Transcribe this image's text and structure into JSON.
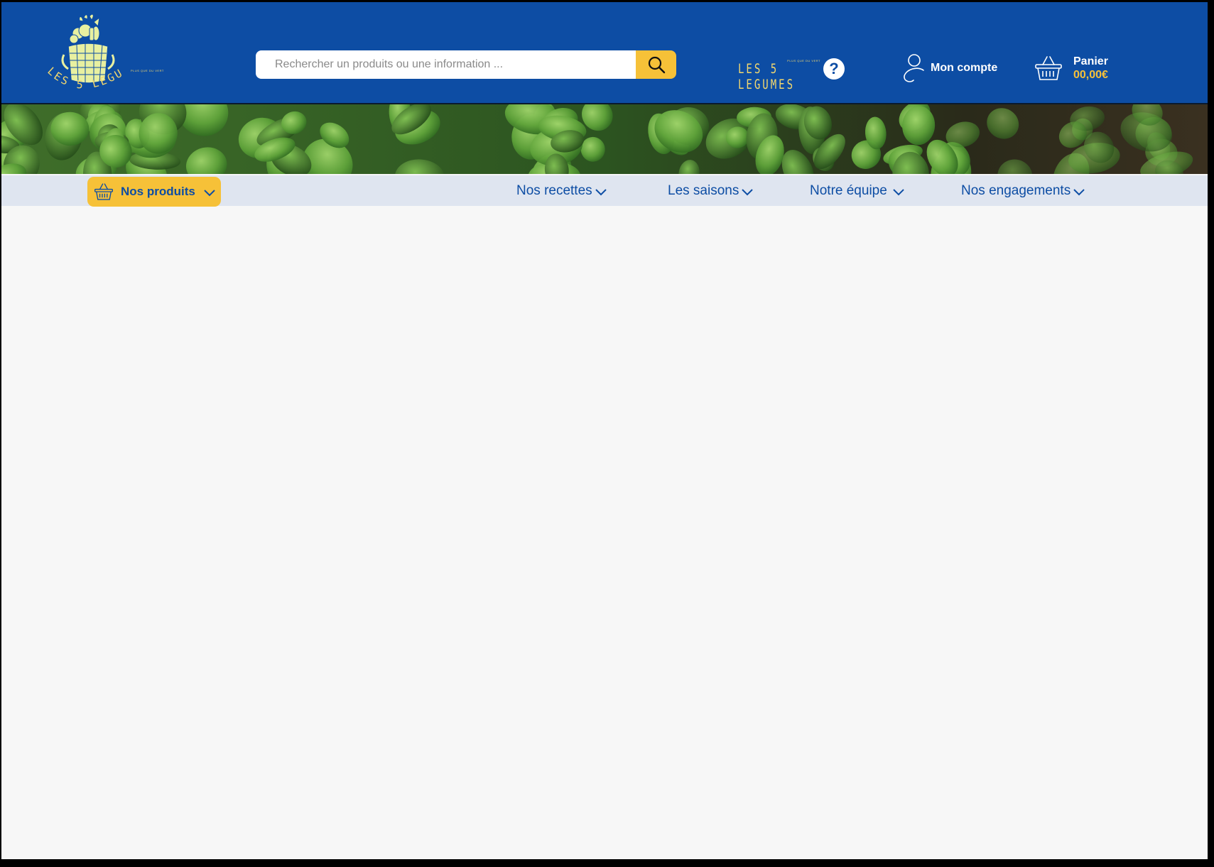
{
  "header": {
    "logo": {
      "brand_name": "LES 5 LEGUMES",
      "tagline": "PLUS QUE DU VERT",
      "icon": "vegetable-basket-logo"
    },
    "search": {
      "placeholder": "Rechercher un produits ou une information ...",
      "value": "",
      "icon": "search-icon"
    },
    "help": {
      "brand_name": "LES 5 LEGUMES",
      "tagline": "PLUS QUE DU VERT",
      "icon": "question-icon"
    },
    "account": {
      "label": "Mon compte",
      "icon": "user-icon"
    },
    "cart": {
      "label": "Panier",
      "total": "00,00€",
      "icon": "basket-icon"
    }
  },
  "banner": {
    "image": "lettuce-seedlings-photo"
  },
  "nav": {
    "products": {
      "label": "Nos produits",
      "icon": "basket-icon"
    },
    "items": [
      {
        "label": "Nos recettes"
      },
      {
        "label": "Les saisons"
      },
      {
        "label": "Notre équipe"
      },
      {
        "label": "Nos engagements"
      }
    ]
  },
  "colors": {
    "header_blue": "#0d4da4",
    "accent_yellow": "#f6c138",
    "logo_yellow": "#f3d86e",
    "nav_background": "#dfe5f0",
    "page_background": "#f7f7f7"
  }
}
